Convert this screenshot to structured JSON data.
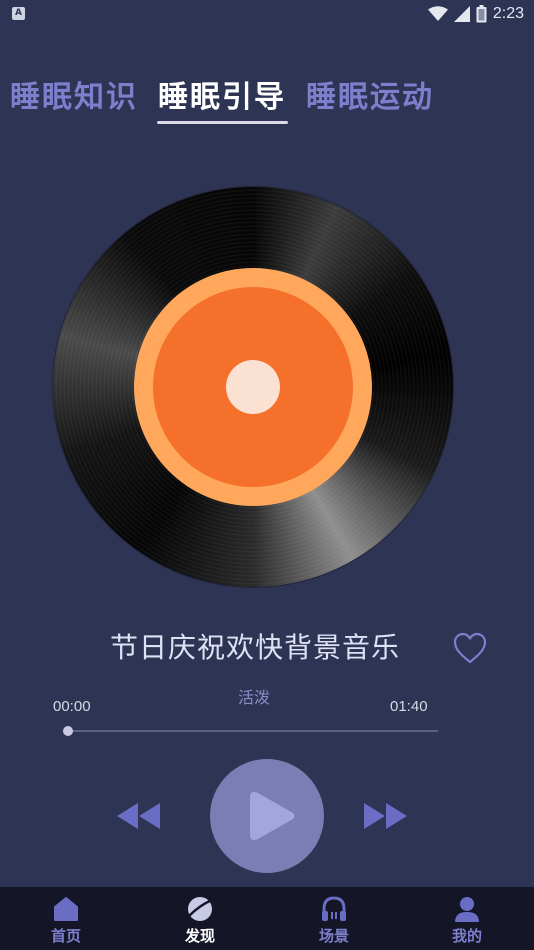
{
  "status_bar": {
    "app_icon": "A",
    "time": "2:23",
    "icons": [
      "wifi-icon",
      "signal-icon",
      "battery-icon"
    ]
  },
  "tabs": [
    {
      "label": "睡眠知识",
      "active": false
    },
    {
      "label": "睡眠引导",
      "active": true
    },
    {
      "label": "睡眠运动",
      "active": false
    }
  ],
  "player": {
    "title": "节日庆祝欢快背景音乐",
    "tag": "活泼",
    "current_time": "00:00",
    "total_time": "01:40",
    "progress": 0.0,
    "favorite": false,
    "icons": {
      "favorite": "heart-outline-icon",
      "prev": "rewind-icon",
      "play": "play-icon",
      "next": "fast-forward-icon"
    }
  },
  "bottom_nav": [
    {
      "label": "首页",
      "icon": "home-icon",
      "active": false
    },
    {
      "label": "发现",
      "icon": "planet-icon",
      "active": true
    },
    {
      "label": "场景",
      "icon": "headphones-icon",
      "active": false
    },
    {
      "label": "我的",
      "icon": "user-icon",
      "active": false
    }
  ],
  "colors": {
    "background": "#2e3454",
    "accent": "#7d7fcd",
    "record_label": "#f5702a",
    "record_ring": "#ffa85c",
    "nav_background": "#141527"
  }
}
